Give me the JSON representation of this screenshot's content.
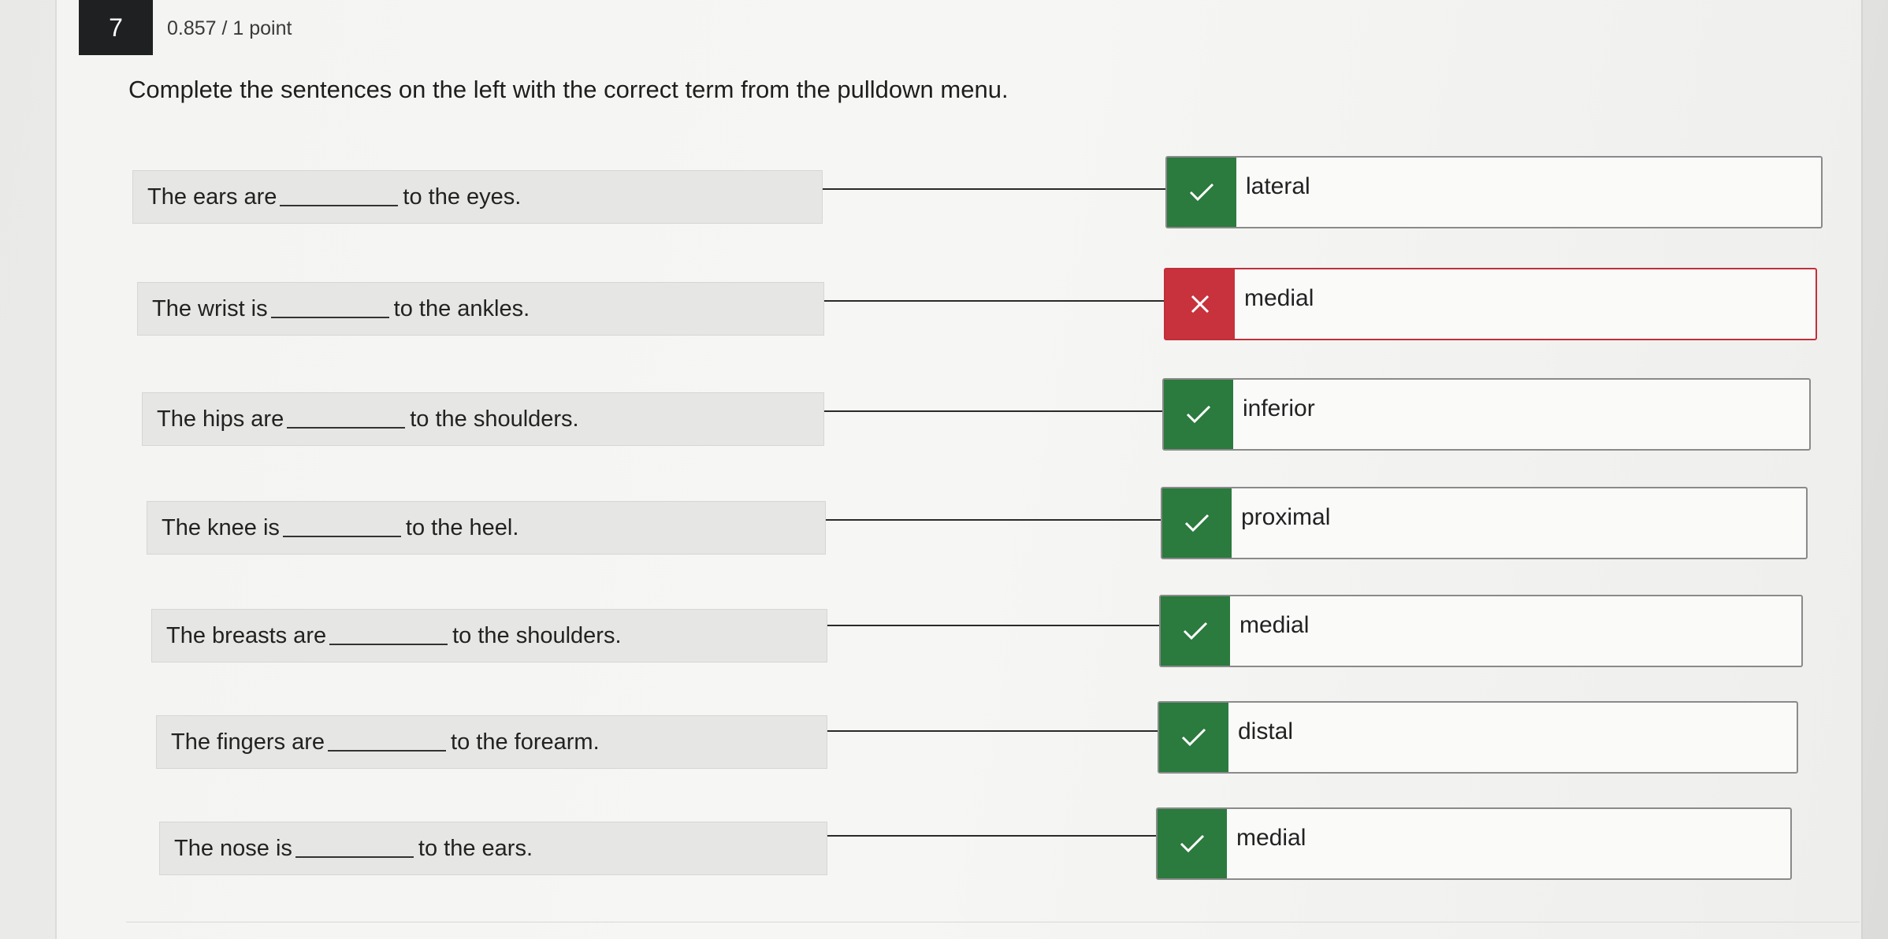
{
  "question": {
    "number": "7",
    "points": "0.857 / 1 point",
    "instructions": "Complete the sentences on the left with the correct term from the pulldown menu."
  },
  "rows": [
    {
      "before": "The ears are",
      "after": "to the eyes.",
      "answer": "lateral",
      "status": "correct",
      "status_icon": "check-icon"
    },
    {
      "before": "The wrist is",
      "after": "to the ankles.",
      "answer": "medial",
      "status": "incorrect",
      "status_icon": "x-icon"
    },
    {
      "before": "The hips are",
      "after": "to the shoulders.",
      "answer": "inferior",
      "status": "correct",
      "status_icon": "check-icon"
    },
    {
      "before": "The knee is",
      "after": "to the heel.",
      "answer": "proximal",
      "status": "correct",
      "status_icon": "check-icon"
    },
    {
      "before": "The breasts are",
      "after": "to the shoulders.",
      "answer": "medial",
      "status": "correct",
      "status_icon": "check-icon"
    },
    {
      "before": "The fingers are",
      "after": "to the forearm.",
      "answer": "distal",
      "status": "correct",
      "status_icon": "check-icon"
    },
    {
      "before": "The nose is",
      "after": "to the ears.",
      "answer": "medial",
      "status": "correct",
      "status_icon": "check-icon"
    }
  ],
  "colors": {
    "correct": "#2b7a3e",
    "incorrect": "#c8323c",
    "question_badge": "#1f2022"
  }
}
